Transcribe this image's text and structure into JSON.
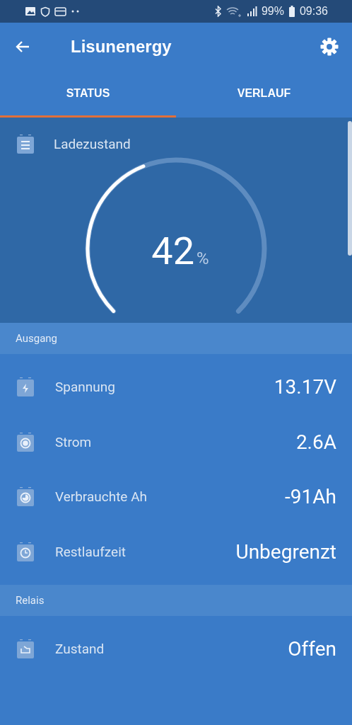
{
  "status_bar": {
    "battery": "99%",
    "time": "09:36"
  },
  "app_bar": {
    "title": "Lisunenergy"
  },
  "tabs": [
    {
      "label": "STATUS",
      "selected": true
    },
    {
      "label": "VERLAUF",
      "selected": false
    }
  ],
  "charge": {
    "label": "Ladezustand",
    "value": "42",
    "unit": "%"
  },
  "sections": [
    {
      "title": "Ausgang",
      "rows": [
        {
          "kind": "voltage",
          "label": "Spannung",
          "value": "13.17V"
        },
        {
          "kind": "current",
          "label": "Strom",
          "value": "2.6A"
        },
        {
          "kind": "consumed",
          "label": "Verbrauchte Ah",
          "value": "-91Ah"
        },
        {
          "kind": "time",
          "label": "Restlaufzeit",
          "value": "Unbegrenzt"
        }
      ]
    },
    {
      "title": "Relais",
      "rows": [
        {
          "kind": "relay",
          "label": "Zustand",
          "value": "Offen"
        }
      ]
    }
  ]
}
